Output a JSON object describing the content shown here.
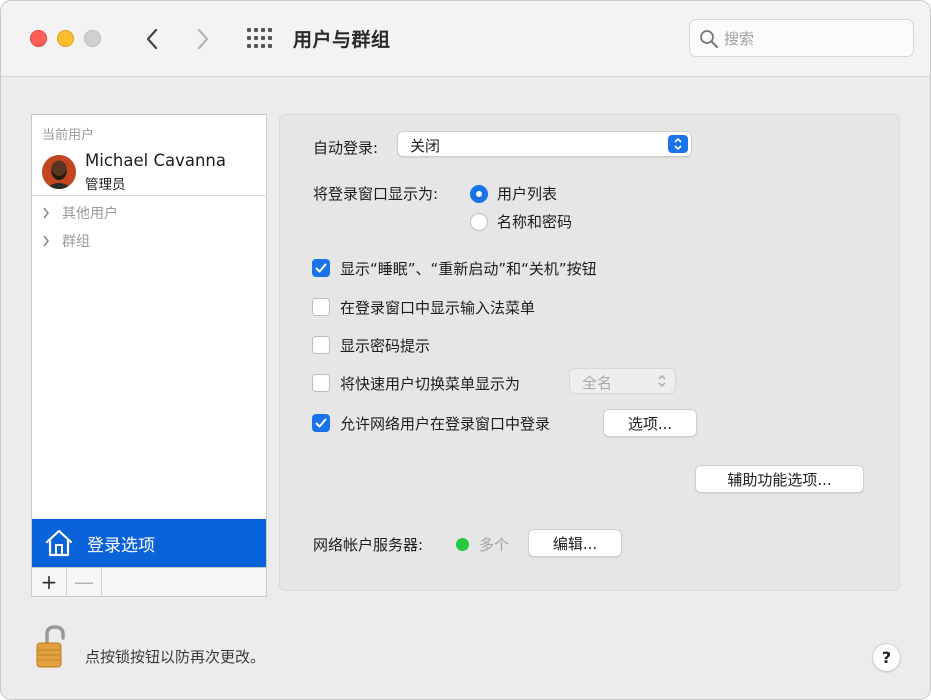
{
  "window": {
    "title": "用户与群组"
  },
  "search": {
    "placeholder": "搜索",
    "value": ""
  },
  "sidebar": {
    "current_users_header": "当前用户",
    "current_user": {
      "name": "Michael Cavanna",
      "role": "管理员"
    },
    "other_users_label": "其他用户",
    "groups_label": "群组",
    "login_options_label": "登录选项",
    "add_label": "+",
    "remove_label": "—"
  },
  "main": {
    "auto_login": {
      "label": "自动登录:",
      "value": "关闭"
    },
    "display_login_window": {
      "label": "将登录窗口显示为:",
      "options": [
        {
          "label": "用户列表",
          "selected": true
        },
        {
          "label": "名称和密码",
          "selected": false
        }
      ]
    },
    "checkboxes": [
      {
        "label": "显示“睡眠”、“重新启动”和“关机”按钮",
        "checked": true
      },
      {
        "label": "在登录窗口中显示输入法菜单",
        "checked": false
      },
      {
        "label": "显示密码提示",
        "checked": false
      },
      {
        "label": "将快速用户切换菜单显示为",
        "checked": false,
        "popup_value": "全名"
      },
      {
        "label": "允许网络用户在登录窗口中登录",
        "checked": true,
        "button_label": "选项..."
      }
    ],
    "accessibility_button": "辅助功能选项...",
    "network_server": {
      "label": "网络帐户服务器:",
      "status": "多个",
      "status_color": "#27c93f",
      "edit_label": "编辑..."
    }
  },
  "footer": {
    "lock_text": "点按锁按钮以防再次更改。",
    "help_label": "?"
  },
  "colors": {
    "accent": "#1a73e8",
    "selection": "#0a63d8"
  }
}
